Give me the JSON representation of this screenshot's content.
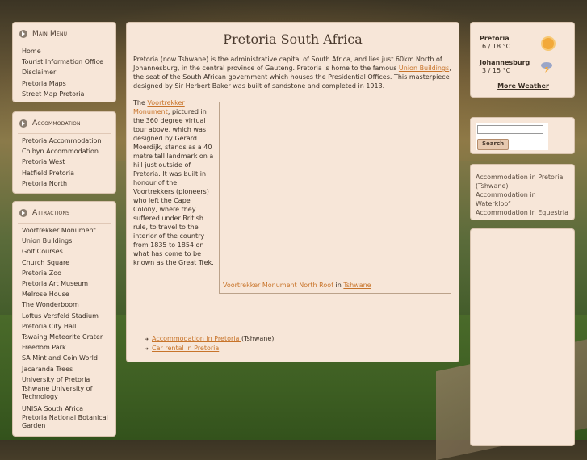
{
  "sidebar": {
    "main_menu": {
      "title": "Main Menu",
      "items": [
        "Home",
        "Tourist Information Office",
        "Disclaimer",
        "Pretoria Maps",
        "Street Map Pretoria"
      ]
    },
    "accommodation": {
      "title": "Accommodation",
      "items": [
        "Pretoria Accommodation",
        "Colbyn Accommodation",
        "Pretoria West",
        "Hatfield Pretoria",
        "Pretoria North"
      ]
    },
    "attractions": {
      "title": "Attractions",
      "items": [
        "Voortrekker Monument",
        "Union Buildings",
        "Golf Courses",
        "Church Square",
        "Pretoria Zoo",
        "Pretoria Art Museum",
        "Melrose House",
        "The Wonderboom",
        "Loftus Versfeld Stadium",
        "Pretoria City Hall",
        "Tswaing Meteorite Crater",
        "Freedom Park",
        "SA Mint and Coin World",
        "Jacaranda Trees",
        "University of Pretoria",
        "Tshwane University of Technology",
        "UNISA South Africa",
        "Pretoria National Botanical Garden"
      ]
    }
  },
  "main": {
    "title": "Pretoria South Africa",
    "intro_a": "Pretoria (now Tshwane) is the administrative capital of South Africa, and lies just 60km North of Johannesburg, in the central province of Gauteng. Pretoria is home to the famous ",
    "intro_link": "Union Buildings",
    "intro_b": ", the seat of the South African government which houses the Presidential Offices. This masterpiece designed by Sir Herbert Baker was built of sandstone and completed in 1913.",
    "left_a": "The ",
    "left_link": "Voortrekker Monument",
    "left_b": ", pictured in the 360 degree virtual tour above, which was designed by Gerard Moerdijk, stands as a 40 metre tall landmark on a hill just outside of Pretoria. It was built in honour of the Voortrekkers (pioneers) who left the Cape Colony, where they suffered under British rule, to travel to the interior of the country from 1835 to 1854 on what has come to be known as the Great Trek.",
    "tour_caption": "Voortrekker Monument North Roof",
    "tour_in": " in ",
    "tour_place": "Tshwane",
    "bottom_links": [
      {
        "link": "Accommodation in Pretoria ",
        "rest": "(Tshwane)"
      },
      {
        "link": "Car rental in Pretoria",
        "rest": ""
      }
    ]
  },
  "weather": {
    "cities": [
      {
        "name": "Pretoria",
        "temp": "6 / 18 °C",
        "icon": "sun-icon"
      },
      {
        "name": "Johannesburg",
        "temp": "3 / 15 °C",
        "icon": "storm-icon"
      }
    ],
    "more": "More Weather"
  },
  "search": {
    "button": "Search",
    "value": ""
  },
  "right_accommodation": [
    "Accommodation in Pretoria (Tshwane)",
    "Accommodation in Waterkloof",
    "Accommodation in Equestria"
  ],
  "colors": {
    "panel": "#f7e6d8",
    "link": "#c8742a",
    "text": "#3a2f25"
  }
}
